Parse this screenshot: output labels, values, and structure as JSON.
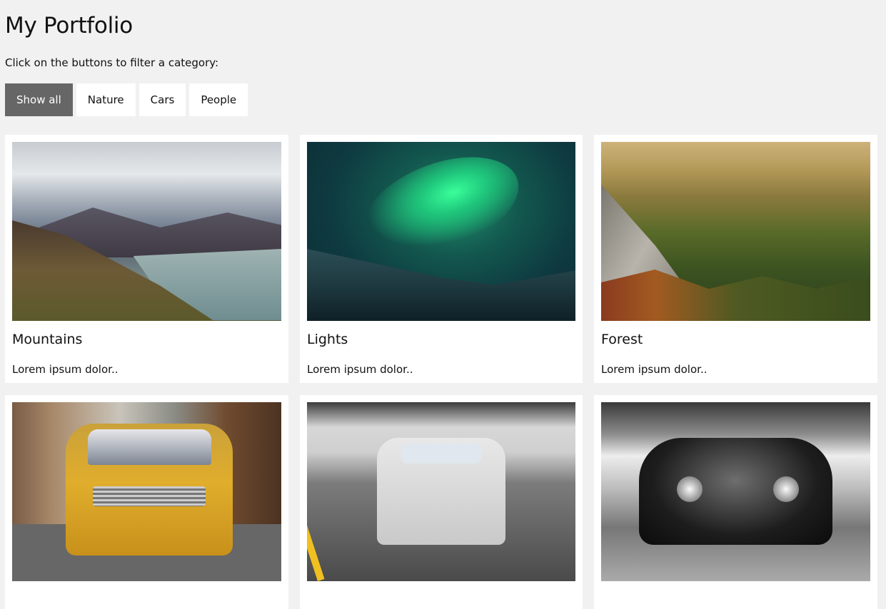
{
  "page": {
    "title": "My Portfolio",
    "intro": "Click on the buttons to filter a category:"
  },
  "filters": [
    {
      "label": "Show all",
      "active": true
    },
    {
      "label": "Nature",
      "active": false
    },
    {
      "label": "Cars",
      "active": false
    },
    {
      "label": "People",
      "active": false
    }
  ],
  "cards": [
    {
      "title": "Mountains",
      "text": "Lorem ipsum dolor..",
      "image": "mountains-photo"
    },
    {
      "title": "Lights",
      "text": "Lorem ipsum dolor..",
      "image": "northern-lights-photo"
    },
    {
      "title": "Forest",
      "text": "Lorem ipsum dolor..",
      "image": "forest-photo"
    },
    {
      "image": "yellow-car-photo"
    },
    {
      "image": "white-car-photo"
    },
    {
      "image": "black-car-photo"
    }
  ],
  "colors": {
    "background": "#f1f1f1",
    "active_button": "#666666",
    "card": "#ffffff"
  }
}
